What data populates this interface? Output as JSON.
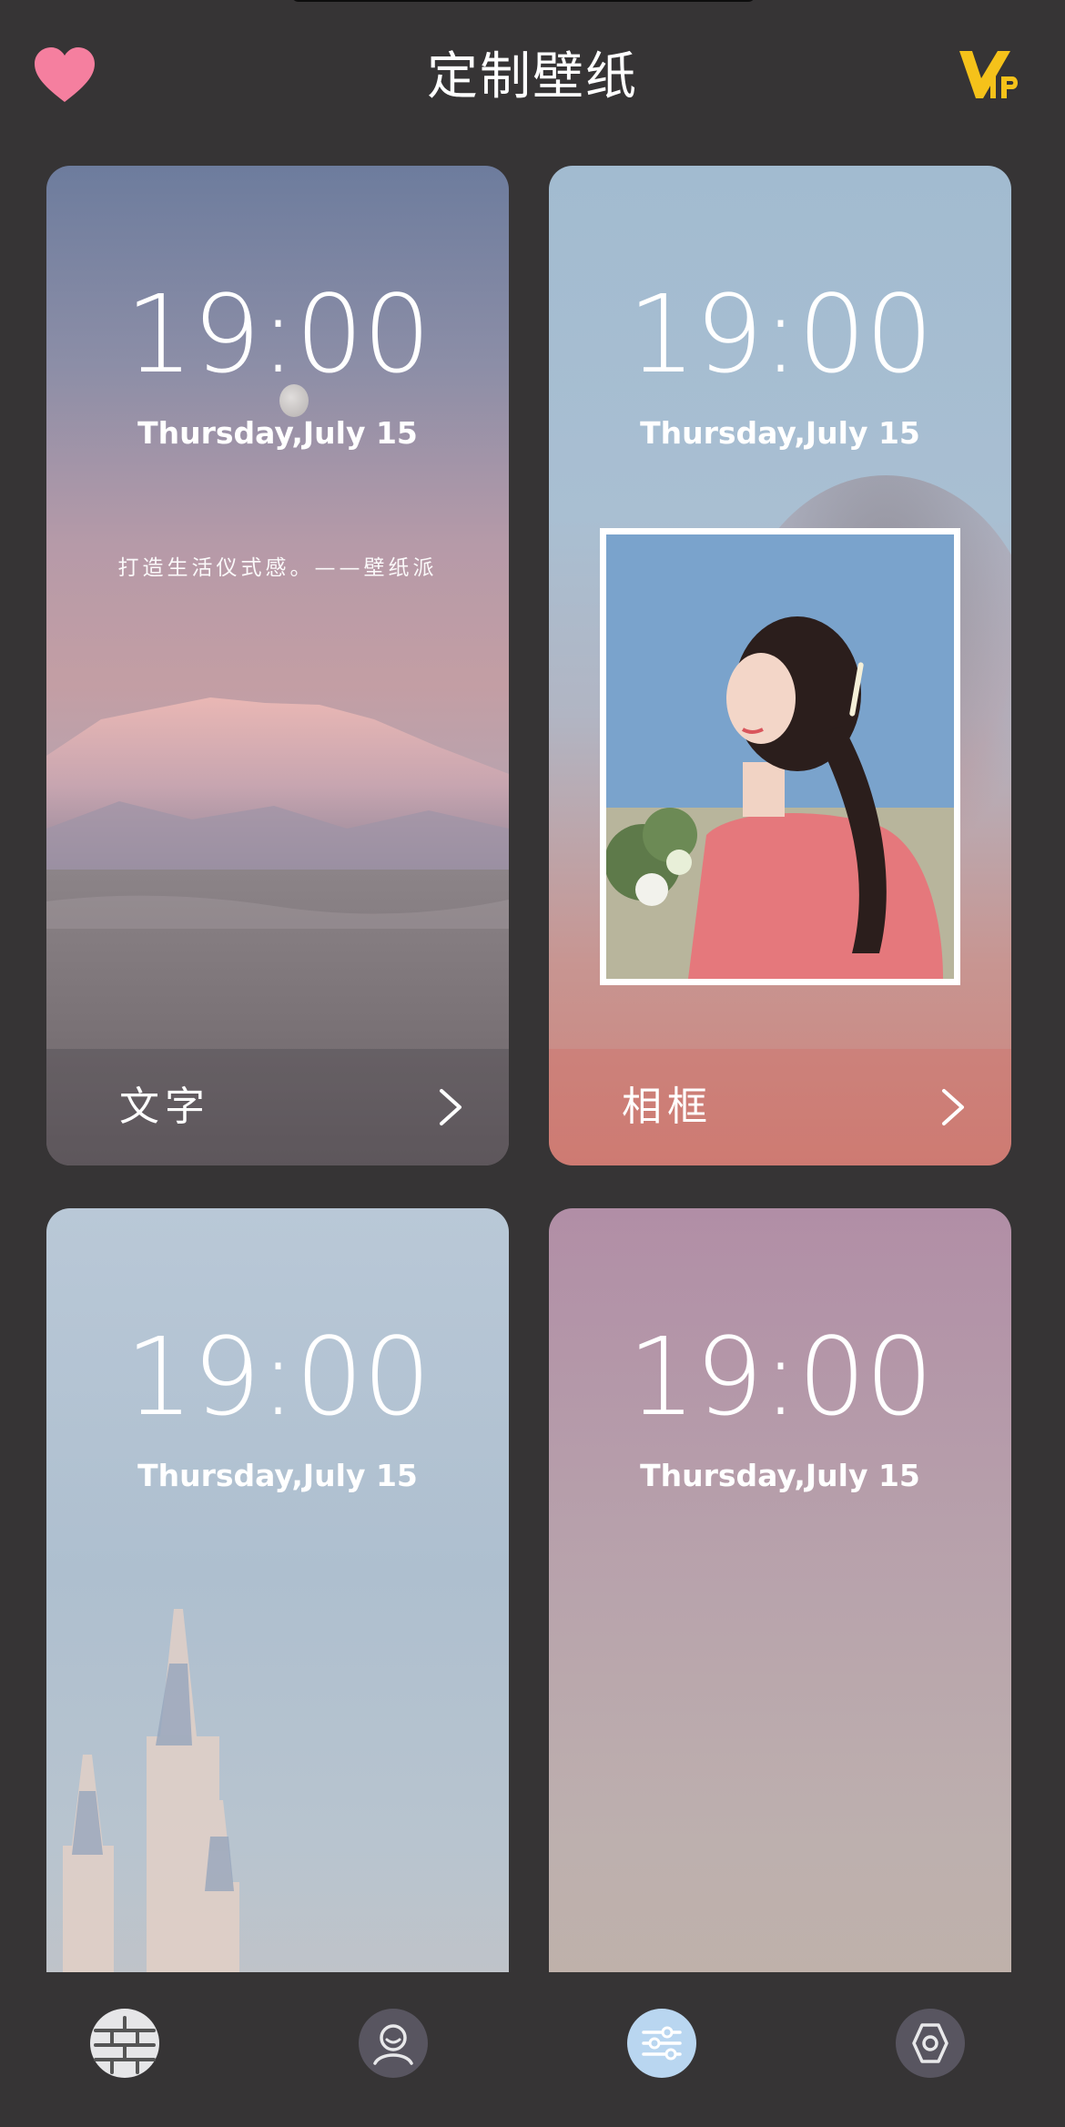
{
  "header": {
    "title": "定制壁纸",
    "vip_label": "VIP"
  },
  "cards": [
    {
      "time": "19:00",
      "date": "Thursday,July 15",
      "quote": "打造生活仪式感。——壁纸派",
      "label": "文字"
    },
    {
      "time": "19:00",
      "date": "Thursday,July 15",
      "label": "相框"
    },
    {
      "time": "19:00",
      "date": "Thursday,July 15"
    },
    {
      "time": "19:00",
      "date": "Thursday,July 15"
    }
  ],
  "nav": {
    "items": [
      {
        "icon": "brick-wall-icon",
        "active": false
      },
      {
        "icon": "avatar-face-icon",
        "active": false
      },
      {
        "icon": "sliders-icon",
        "active": true
      },
      {
        "icon": "hexagon-settings-icon",
        "active": false
      }
    ]
  },
  "colors": {
    "background": "#363435",
    "heart": "#f57f9f",
    "vip": "#f5c21a",
    "nav_active": "#b9d6f0"
  }
}
